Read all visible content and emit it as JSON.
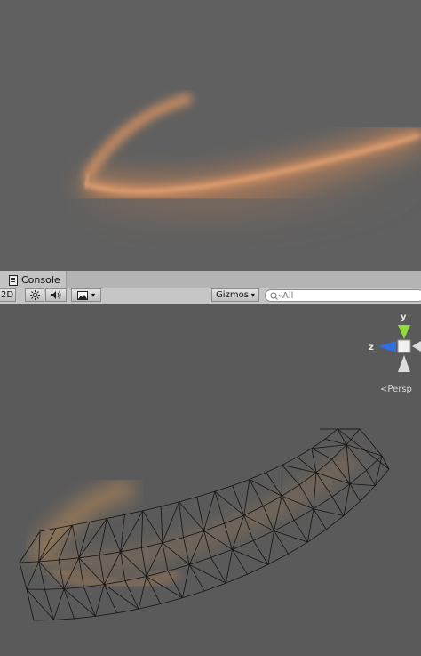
{
  "console_tab": {
    "label": "Console"
  },
  "toolbar": {
    "mode_2d": "2D",
    "gizmos_label": "Gizmos",
    "gizmos_caret": "▾",
    "search_placeholder": "All",
    "image_caret": "▾"
  },
  "gizmo": {
    "y_label": "y",
    "z_label": "z",
    "projection_label": "Persp"
  },
  "icons": [
    "console-icon",
    "lighting-icon",
    "audio-icon",
    "image-effects-icon",
    "search-icon"
  ],
  "colors": {
    "glow": "#e88a4c",
    "background": "#5c5c5c",
    "y_axis": "#8fdc3a",
    "z_axis": "#2f6fe0"
  }
}
